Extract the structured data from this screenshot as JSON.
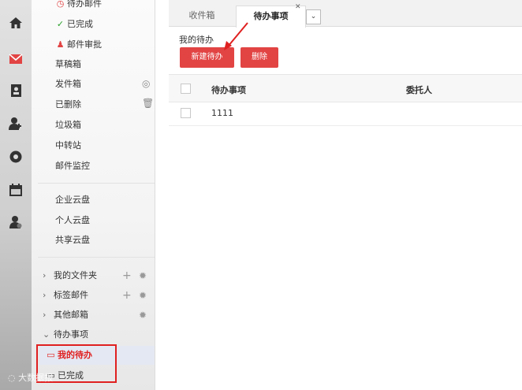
{
  "rail": {
    "icons": [
      "home-icon",
      "mail-icon",
      "contacts-icon",
      "add-user-icon",
      "settings-icon",
      "calendar-icon",
      "user-admin-icon"
    ]
  },
  "menu": {
    "mail_items": [
      {
        "label": "待办邮件",
        "icon": "clock-icon"
      },
      {
        "label": "已完成",
        "icon": "check-icon"
      },
      {
        "label": "邮件审批",
        "icon": "user-stamp-icon"
      },
      {
        "label": "草稿箱"
      },
      {
        "label": "发件箱",
        "action": "target-icon"
      },
      {
        "label": "已删除",
        "action": "trash-icon"
      },
      {
        "label": "垃圾箱"
      },
      {
        "label": "中转站"
      },
      {
        "label": "邮件监控"
      }
    ],
    "cloud_items": [
      {
        "label": "企业云盘"
      },
      {
        "label": "个人云盘"
      },
      {
        "label": "共享云盘"
      }
    ],
    "groups": [
      {
        "label": "我的文件夹",
        "chevron": "›",
        "plus": true,
        "gear": true
      },
      {
        "label": "标签邮件",
        "chevron": "›",
        "plus": true,
        "gear": true
      },
      {
        "label": "其他邮箱",
        "chevron": "›",
        "plus": false,
        "gear": true
      },
      {
        "label": "待办事项",
        "chevron": "⌄",
        "plus": false,
        "gear": false
      }
    ],
    "todo_sub": [
      {
        "label": "我的待办",
        "selected": true
      },
      {
        "label": "已完成",
        "selected": false
      }
    ]
  },
  "tabs": [
    {
      "label": "收件箱",
      "active": false
    },
    {
      "label": "待办事项",
      "active": true
    }
  ],
  "page": {
    "title": "我的待办",
    "new_button": "新建待办",
    "delete_button": "删除"
  },
  "table": {
    "columns": [
      "待办事项",
      "委托人"
    ],
    "rows": [
      {
        "item": "1111",
        "delegate": ""
      }
    ]
  },
  "watermark": "大数据报",
  "colors": {
    "accent": "#e24444",
    "annotation": "#e02020"
  }
}
